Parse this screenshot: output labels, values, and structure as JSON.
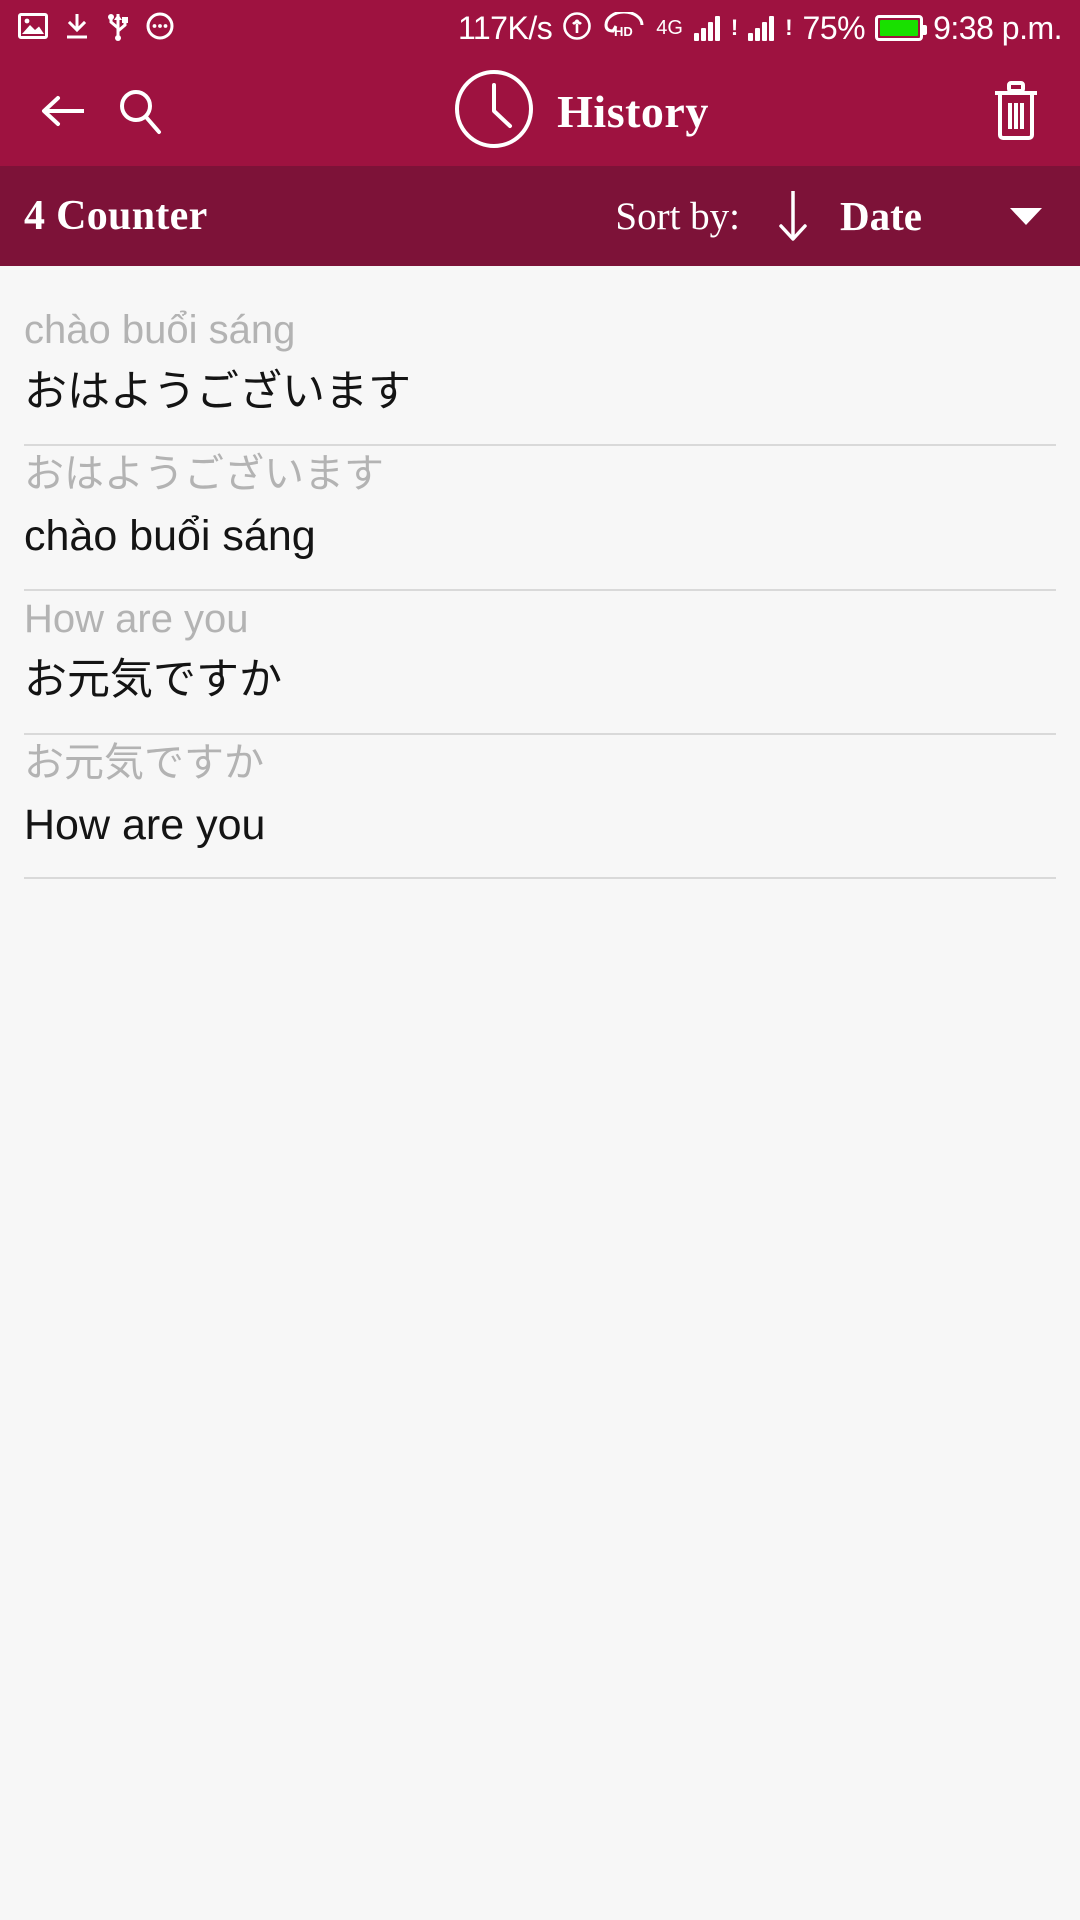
{
  "statusbar": {
    "left_icons": [
      "image-icon",
      "download-icon",
      "usb-icon",
      "more-icon"
    ],
    "network_speed": "117K/s",
    "hotspot_icon": "hotspot-icon",
    "hd_label": "HD",
    "network_type": "4G",
    "battery_percent": "75%",
    "time": "9:38 p.m."
  },
  "appbar": {
    "back_icon": "back-arrow-icon",
    "search_icon": "search-icon",
    "clock_icon": "clock-icon",
    "title": "History",
    "delete_icon": "trash-icon"
  },
  "sortbar": {
    "counter": "4 Counter",
    "sort_label": "Sort by:",
    "sort_direction_icon": "arrow-down-icon",
    "sort_value": "Date",
    "dropdown_icon": "caret-down-icon"
  },
  "list": {
    "items": [
      {
        "source": "chào buổi sáng",
        "target": "おはようございます"
      },
      {
        "source": "おはようございます",
        "target": "chào buổi sáng"
      },
      {
        "source": "How are you",
        "target": "お元気ですか"
      },
      {
        "source": "お元気ですか",
        "target": "How are you"
      }
    ]
  },
  "colors": {
    "appbar_bg": "#9e1240",
    "sortbar_bg": "#7d1238",
    "page_bg": "#f7f7f7",
    "battery_fill": "#19e000",
    "source_text": "#b3b3b3",
    "target_text": "#141414",
    "divider": "#d9d9d9"
  }
}
